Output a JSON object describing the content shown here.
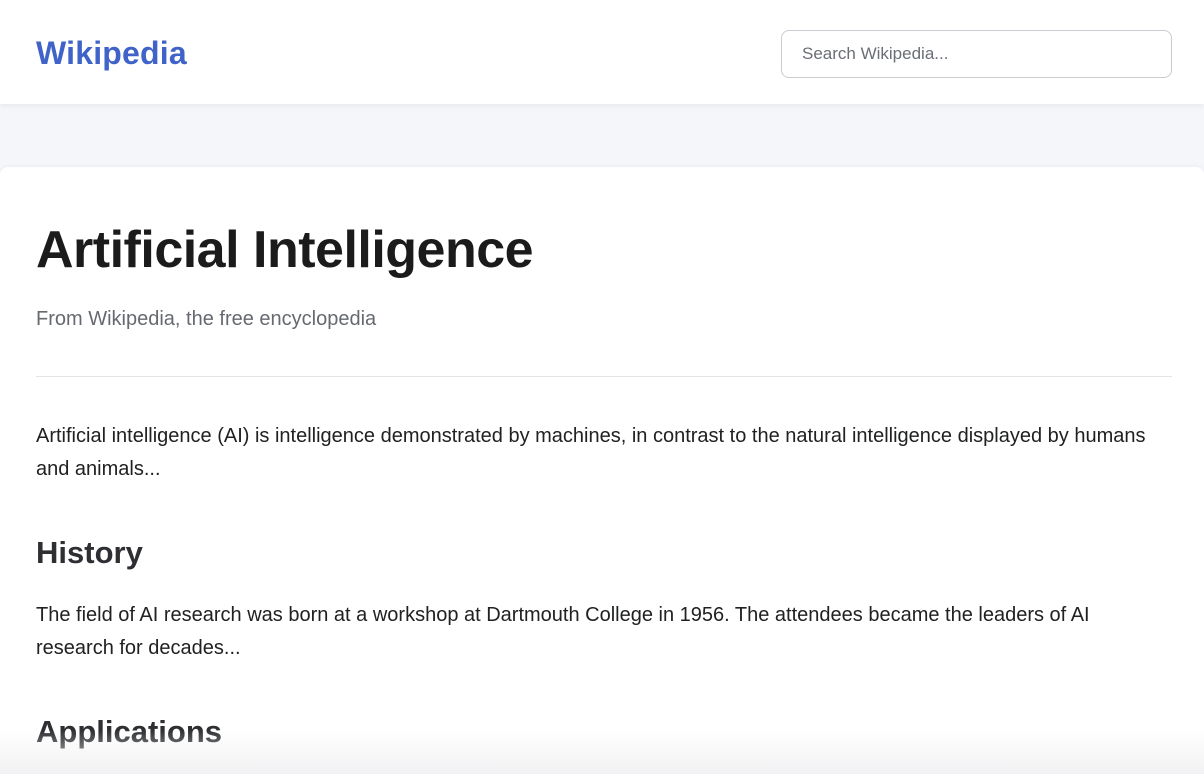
{
  "header": {
    "logo": "Wikipedia",
    "search_placeholder": "Search Wikipedia..."
  },
  "article": {
    "title": "Artificial Intelligence",
    "tagline": "From Wikipedia, the free encyclopedia",
    "intro": "Artificial intelligence (AI) is intelligence demonstrated by machines, in contrast to the natural intelligence displayed by humans and animals...",
    "sections": [
      {
        "heading": "History",
        "body": "The field of AI research was born at a workshop at Dartmouth College in 1956. The attendees became the leaders of AI research for decades..."
      },
      {
        "heading": "Applications"
      }
    ]
  },
  "colors": {
    "brand": "#3f63c8",
    "background": "#f5f6fa",
    "text": "#202122",
    "muted": "#666a70"
  }
}
